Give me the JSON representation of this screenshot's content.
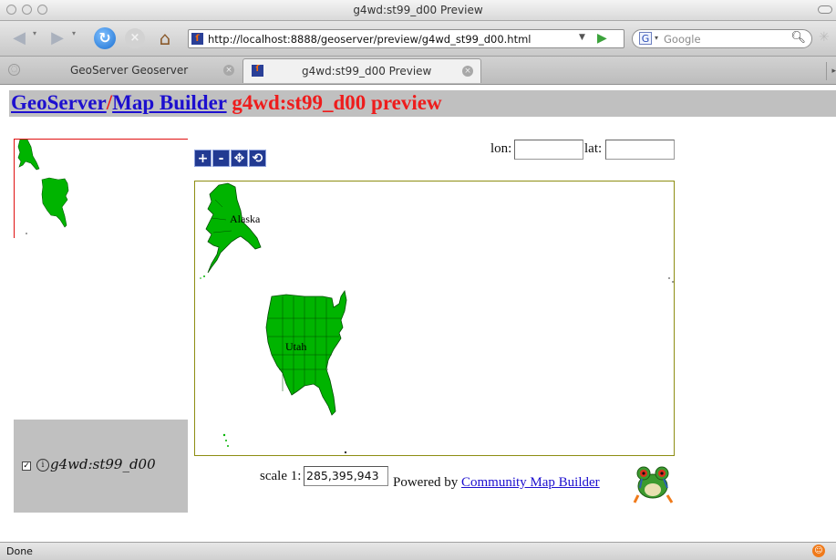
{
  "window": {
    "title": "g4wd:st99_d00 Preview"
  },
  "toolbar": {
    "back_icon": "back-arrow-icon",
    "forward_icon": "forward-arrow-icon",
    "url": "http://localhost:8888/geoserver/preview/g4wd_st99_d00.html",
    "search_placeholder": "Google"
  },
  "tabs": [
    {
      "label": "GeoServer Geoserver",
      "active": false
    },
    {
      "label": "g4wd:st99_d00 Preview",
      "active": true
    }
  ],
  "header": {
    "link1": "GeoServer",
    "separator": "/",
    "link2": "Map Builder",
    "layer": "g4wd:st99_d00 preview"
  },
  "coords": {
    "lon_label": "lon:",
    "lat_label": "lat:",
    "lon_value": "",
    "lat_value": ""
  },
  "zoom_tools": [
    "+",
    "-",
    "✥",
    "⟲"
  ],
  "map": {
    "labels": [
      "Alaska",
      "Utah"
    ],
    "fill_color": "#00b400"
  },
  "legend": {
    "checked": true,
    "info": "i",
    "layer_name": "g4wd:st99_d00"
  },
  "scale": {
    "label": "scale 1:",
    "value": "285,395,943"
  },
  "powered": {
    "prefix": "Powered by",
    "link": "Community Map Builder"
  },
  "status": {
    "text": "Done"
  }
}
